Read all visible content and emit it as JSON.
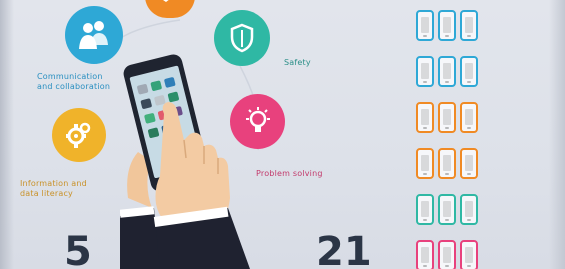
{
  "competences": {
    "communication": "Communication\nand collaboration",
    "safety": "Safety",
    "information": "Information and\ndata literacy",
    "problem_solving": "Problem solving"
  },
  "numbers": {
    "left": "5",
    "right": "21"
  },
  "colors": {
    "communication": "#2ea8d6",
    "safety": "#2fb8a4",
    "information": "#f0b32a",
    "problem_solving": "#e8417d",
    "digital_content": "#f08a24"
  },
  "icons": {
    "communication": "people-icon",
    "safety": "shield-icon",
    "information": "gears-icon",
    "problem_solving": "lightbulb-icon",
    "digital_content": "pencil-icon"
  },
  "competence_grid": {
    "row_colors": [
      "#2ea8d6",
      "#2ea8d6",
      "#f08a24",
      "#f08a24",
      "#2fb8a4",
      "#e8417d"
    ]
  }
}
